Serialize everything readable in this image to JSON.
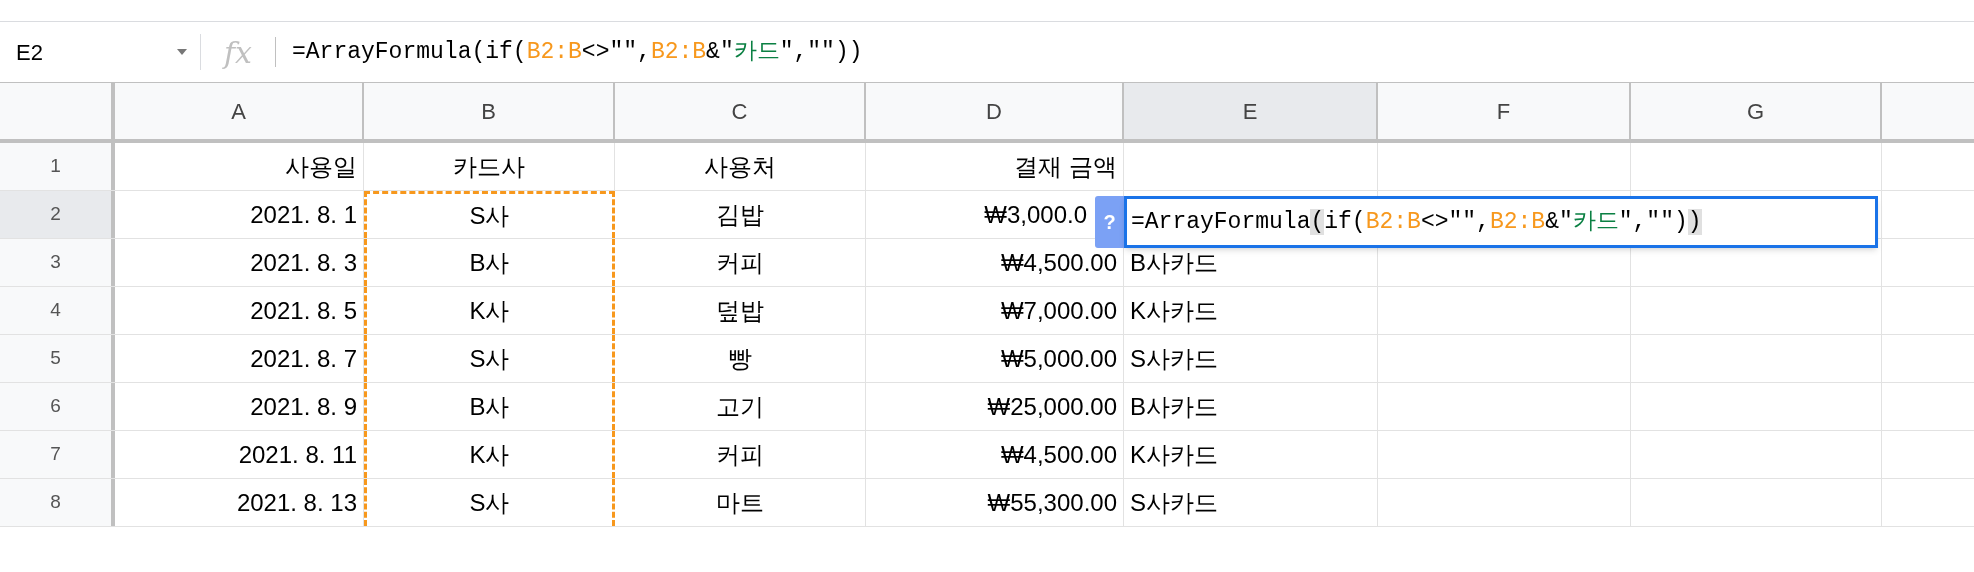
{
  "name_box": {
    "value": "E2"
  },
  "formula_bar": {
    "fx": "fx",
    "tokens": [
      {
        "kind": "plain",
        "text": "=ArrayFormula(if("
      },
      {
        "kind": "range",
        "text": "B2:B"
      },
      {
        "kind": "plain",
        "text": "<>\"\","
      },
      {
        "kind": "range",
        "text": "B2:B"
      },
      {
        "kind": "plain",
        "text": "&\""
      },
      {
        "kind": "string",
        "text": "카드"
      },
      {
        "kind": "plain",
        "text": "\",\"\"))"
      }
    ]
  },
  "columns": [
    {
      "label": "A",
      "selected": false
    },
    {
      "label": "B",
      "selected": false,
      "copied": true
    },
    {
      "label": "C",
      "selected": false
    },
    {
      "label": "D",
      "selected": false
    },
    {
      "label": "E",
      "selected": true
    },
    {
      "label": "F",
      "selected": false
    },
    {
      "label": "G",
      "selected": false
    }
  ],
  "rows": [
    {
      "number": "1",
      "selected": false,
      "cells": [
        {
          "text": "사용일"
        },
        {
          "text": "카드사"
        },
        {
          "text": "사용처"
        },
        {
          "text": "결재 금액"
        },
        {
          "text": ""
        }
      ]
    },
    {
      "number": "2",
      "selected": true,
      "cells": [
        {
          "text": "2021. 8. 1"
        },
        {
          "text": "S사"
        },
        {
          "text": "김밥"
        },
        {
          "text": "₩3,000.0"
        },
        {
          "text": ""
        }
      ]
    },
    {
      "number": "3",
      "selected": false,
      "cells": [
        {
          "text": "2021. 8. 3"
        },
        {
          "text": "B사"
        },
        {
          "text": "커피"
        },
        {
          "text": "₩4,500.00"
        },
        {
          "text": "B사카드"
        }
      ]
    },
    {
      "number": "4",
      "selected": false,
      "cells": [
        {
          "text": "2021. 8. 5"
        },
        {
          "text": "K사"
        },
        {
          "text": "덮밥"
        },
        {
          "text": "₩7,000.00"
        },
        {
          "text": "K사카드"
        }
      ]
    },
    {
      "number": "5",
      "selected": false,
      "cells": [
        {
          "text": "2021. 8. 7"
        },
        {
          "text": "S사"
        },
        {
          "text": "빵"
        },
        {
          "text": "₩5,000.00"
        },
        {
          "text": "S사카드"
        }
      ]
    },
    {
      "number": "6",
      "selected": false,
      "cells": [
        {
          "text": "2021. 8. 9"
        },
        {
          "text": "B사"
        },
        {
          "text": "고기"
        },
        {
          "text": "₩25,000.00"
        },
        {
          "text": "B사카드"
        }
      ]
    },
    {
      "number": "7",
      "selected": false,
      "cells": [
        {
          "text": "2021. 8. 11"
        },
        {
          "text": "K사"
        },
        {
          "text": "커피"
        },
        {
          "text": "₩4,500.00"
        },
        {
          "text": "K사카드"
        }
      ]
    },
    {
      "number": "8",
      "selected": false,
      "cells": [
        {
          "text": "2021. 8. 13"
        },
        {
          "text": "S사"
        },
        {
          "text": "마트"
        },
        {
          "text": "₩55,300.00"
        },
        {
          "text": "S사카드"
        }
      ]
    }
  ],
  "editor": {
    "help": "?",
    "tokens": [
      {
        "kind": "plain",
        "text": "=ArrayFormula"
      },
      {
        "kind": "paren",
        "text": "("
      },
      {
        "kind": "plain",
        "text": "if("
      },
      {
        "kind": "range",
        "text": "B2:B"
      },
      {
        "kind": "plain",
        "text": "<>\"\","
      },
      {
        "kind": "range",
        "text": "B2:B"
      },
      {
        "kind": "plain",
        "text": "&\""
      },
      {
        "kind": "string",
        "text": "카드"
      },
      {
        "kind": "plain",
        "text": "\",\"\")"
      },
      {
        "kind": "paren",
        "text": ")"
      }
    ]
  }
}
